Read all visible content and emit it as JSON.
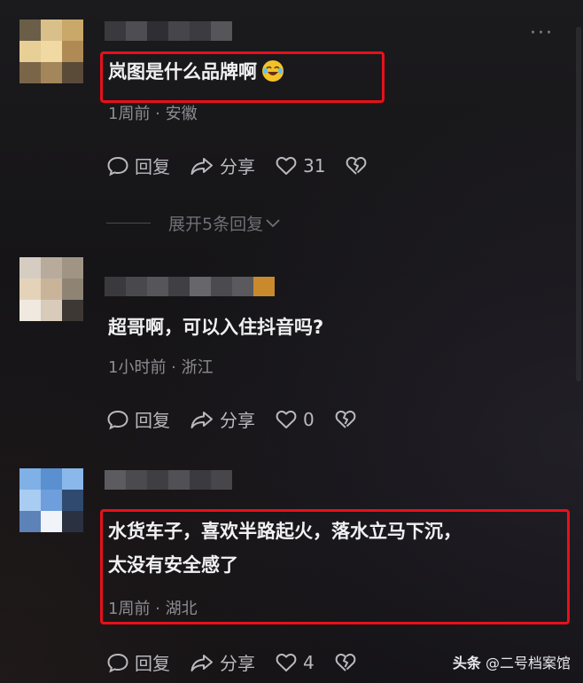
{
  "comments": [
    {
      "text": "岚图是什么品牌啊",
      "emoji": "laughing-tears-emoji",
      "meta": "1周前 · 安徽",
      "reply_label": "回复",
      "share_label": "分享",
      "likes": "31",
      "highlighted": true
    },
    {
      "text": "超哥啊，可以入住抖音吗?",
      "meta": "1小时前 · 浙江",
      "reply_label": "回复",
      "share_label": "分享",
      "likes": "0",
      "highlighted": false
    },
    {
      "text_line1": "水货车子，喜欢半路起火，落水立马下沉，",
      "text_line2": "太没有安全感了",
      "meta": "1周前 · 湖北",
      "reply_label": "回复",
      "share_label": "分享",
      "likes": "4",
      "highlighted": true
    }
  ],
  "expand_replies": "展开5条回复",
  "more_menu": "···",
  "watermark": {
    "brand": "头条",
    "account": "@二号档案馆"
  },
  "colors": {
    "highlight_box": "#e8101a",
    "background": "#151417",
    "text": "#f1f1f3",
    "meta": "#8c8c93"
  }
}
